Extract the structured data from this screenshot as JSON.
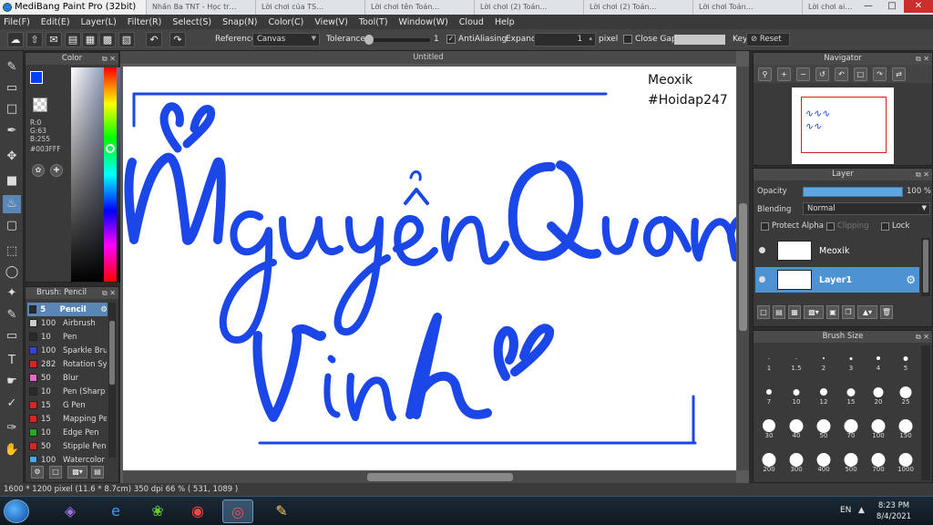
{
  "window": {
    "title": "MediBang Paint Pro (32bit)",
    "browser_tabs": [
      "Nhấn Ba TNT - Học tr…",
      "Lời chơi của TS…",
      "Lời chơi tên Toán…",
      "Lời chơi (2) Toán…",
      "Lời chơi (2) Toán…",
      "Lời chơi Toán…",
      "Lời chơi ai…"
    ]
  },
  "menu": [
    "File(F)",
    "Edit(E)",
    "Layer(L)",
    "Filter(R)",
    "Select(S)",
    "Snap(N)",
    "Color(C)",
    "View(V)",
    "Tool(T)",
    "Window(W)",
    "Cloud",
    "Help"
  ],
  "toolbar": {
    "reference_label": "Reference",
    "reference_value": "Canvas",
    "tolerance_label": "Tolerance",
    "tolerance_value": "1",
    "antialiasing_label": "AntiAliasing",
    "expand_label": "Expand",
    "expand_value": "1",
    "expand_unit": "pixel",
    "close_gaps_label": "Close Gaps",
    "key_label": "Key",
    "reset_label": "Reset"
  },
  "color_panel": {
    "title": "Color",
    "rgb": "R:0\nG:63\nB:255",
    "hex": "#003FFF",
    "foreground": "#003fff",
    "background": "#e02020"
  },
  "brush_panel": {
    "title": "Brush: Pencil",
    "items": [
      {
        "size": "5",
        "name": "Pencil",
        "color": "#2a2a2a",
        "active": true
      },
      {
        "size": "100",
        "name": "Airbrush",
        "color": "#cccccc"
      },
      {
        "size": "10",
        "name": "Pen",
        "color": "#2a2a2a"
      },
      {
        "size": "100",
        "name": "Sparkle Bru",
        "color": "#3344dd"
      },
      {
        "size": "282",
        "name": "Rotation Sy",
        "color": "#dd2222"
      },
      {
        "size": "50",
        "name": "Blur",
        "color": "#ee66cc"
      },
      {
        "size": "10",
        "name": "Pen (Sharp",
        "color": "#2a2a2a"
      },
      {
        "size": "15",
        "name": "G Pen",
        "color": "#dd2222"
      },
      {
        "size": "15",
        "name": "Mapping Pe",
        "color": "#dd2222"
      },
      {
        "size": "10",
        "name": "Edge Pen",
        "color": "#22aa22"
      },
      {
        "size": "50",
        "name": "Stipple Pen",
        "color": "#dd2222"
      },
      {
        "size": "100",
        "name": "Watercolor",
        "color": "#44aaee"
      }
    ]
  },
  "canvas": {
    "tab_title": "Untitled",
    "watermark_line1": "Meoxik",
    "watermark_line2": "#Hoidap247",
    "artwork_color": "#1b47e8"
  },
  "navigator": {
    "title": "Navigator"
  },
  "layer_panel": {
    "title": "Layer",
    "opacity_label": "Opacity",
    "opacity_value": "100 %",
    "opacity_fraction": 1.0,
    "blending_label": "Blending",
    "blending_value": "Normal",
    "protect_alpha": "Protect Alpha",
    "clipping": "Clipping",
    "lock": "Lock",
    "layers": [
      {
        "name": "Meoxik",
        "active": false
      },
      {
        "name": "Layer1",
        "active": true
      }
    ]
  },
  "brush_size_panel": {
    "title": "Brush Size",
    "sizes": [
      "1",
      "1.5",
      "2",
      "3",
      "4",
      "5",
      "7",
      "10",
      "12",
      "15",
      "20",
      "25",
      "30",
      "40",
      "50",
      "70",
      "100",
      "150",
      "200",
      "300",
      "400",
      "500",
      "700",
      "1000"
    ]
  },
  "status": {
    "text": "1600 * 1200 pixel   (11.6 * 8.7cm)   350 dpi   66 %   ( 531, 1089 )"
  },
  "taskbar": {
    "language": "EN",
    "time": "8:23 PM",
    "date": "8/4/2021"
  }
}
